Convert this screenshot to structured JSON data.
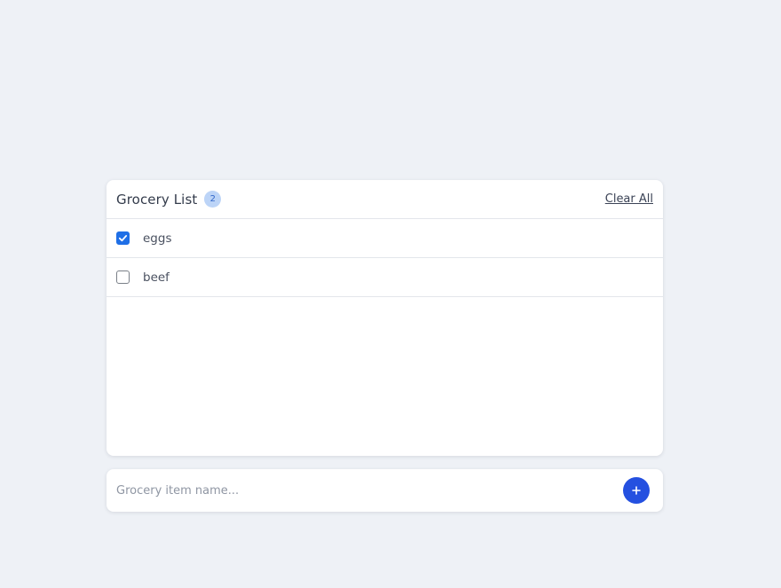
{
  "list": {
    "title": "Grocery List",
    "count": "2",
    "clear_all_label": "Clear All",
    "items": [
      {
        "label": "eggs",
        "checked": true
      },
      {
        "label": "beef",
        "checked": false
      }
    ]
  },
  "add": {
    "placeholder": "Grocery item name...",
    "button_icon": "plus-icon"
  },
  "colors": {
    "background": "#eef1f6",
    "accent": "#2450e0",
    "checkbox_checked": "#1f6fe6",
    "badge_bg": "#bcd4f7"
  }
}
